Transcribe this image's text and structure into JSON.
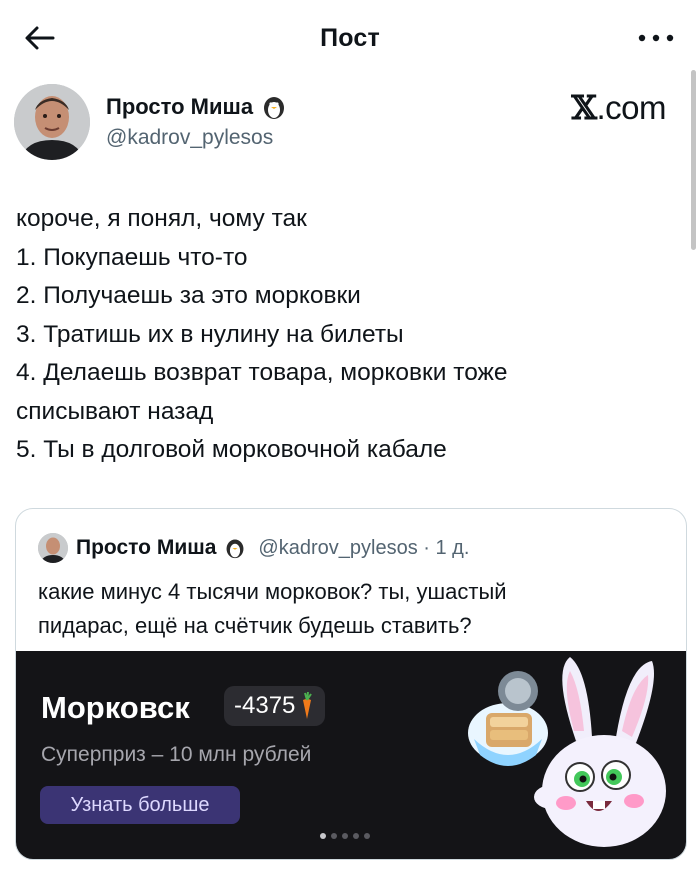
{
  "header": {
    "title": "Пост",
    "back_icon": "arrow-left-icon",
    "more_icon": "more-dots-icon"
  },
  "author": {
    "name": "Просто Миша",
    "emoji": "penguin-icon",
    "handle": "@kadrov_pylesos"
  },
  "watermark": {
    "x_glyph": "𝕏",
    "domain": ".com"
  },
  "post": {
    "lines": [
      "короче, я понял, чому так",
      "1. Покупаешь что-то",
      "2. Получаешь за это морковки",
      "3. Тратишь их в нулину на билеты",
      "4. Делаешь возврат товара, морковки тоже",
      "списывают назад",
      "5. Ты в долговой морковочной кабале"
    ]
  },
  "quote": {
    "name": "Просто Миша",
    "handle": "@kadrov_pylesos · 1 д.",
    "lines": [
      "какие минус 4 тысячи морковок? ты, ушастый",
      "пидарас, ещё на счётчик будешь ставить?"
    ],
    "banner": {
      "title": "Морковск",
      "balance": "-4375",
      "balance_icon": "carrot-icon",
      "subtitle": "Суперприз – 10 млн рублей",
      "button": "Узнать больше",
      "dots_total": 5,
      "dots_active": 0,
      "colors": {
        "background": "#141417",
        "button_bg": "#3b3474",
        "button_text": "#ddd8ff"
      }
    }
  }
}
